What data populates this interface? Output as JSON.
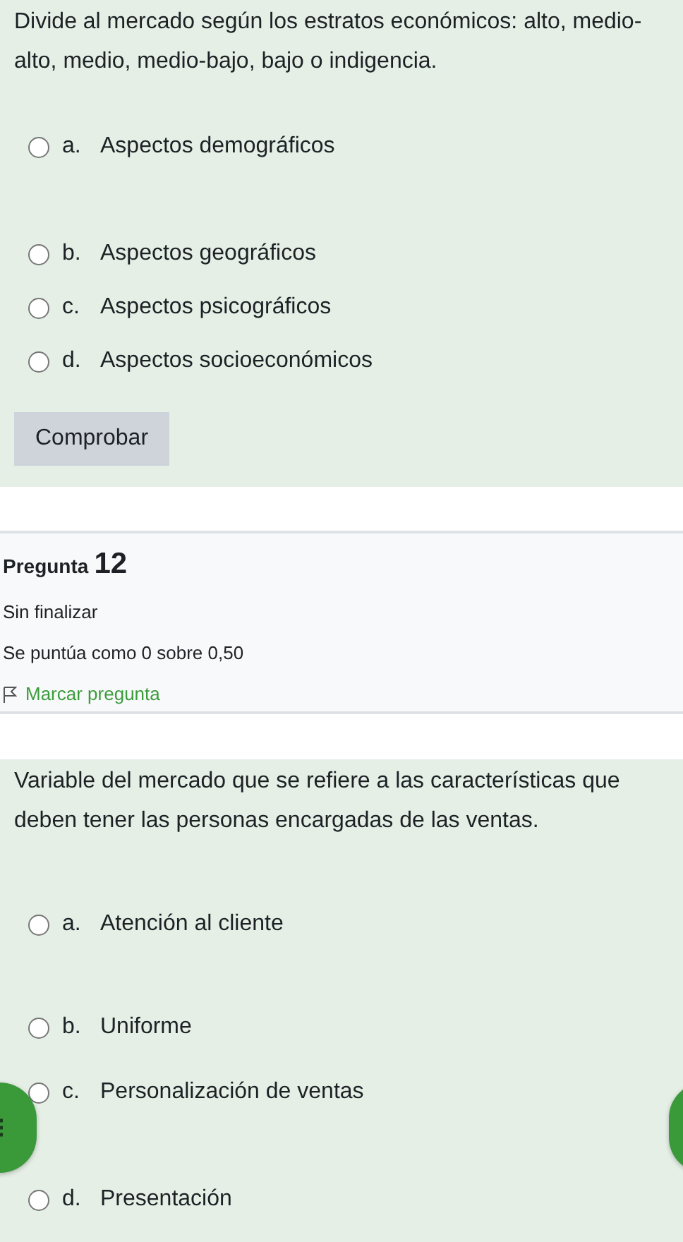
{
  "question_11": {
    "text": "Divide al  mercado según los estratos económicos: alto, medio-alto, medio, medio-bajo, bajo o indigencia.",
    "options": [
      {
        "letter": "a.",
        "text": "Aspectos demográficos",
        "selected": false
      },
      {
        "letter": "b.",
        "text": "Aspectos geográficos",
        "selected": false
      },
      {
        "letter": "c.",
        "text": "Aspectos psicográficos",
        "selected": false
      },
      {
        "letter": "d.",
        "text": "Aspectos socioeconómicos",
        "selected": false
      }
    ],
    "check_button": "Comprobar"
  },
  "question_12_info": {
    "label": "Pregunta",
    "number": "12",
    "status": "Sin finalizar",
    "grade": "Se puntúa como 0 sobre 0,50",
    "flag_link": "Marcar pregunta"
  },
  "question_12": {
    "text": "Variable del mercado que se  refiere a las características que deben tener las personas encargadas de las ventas.",
    "options": [
      {
        "letter": "a.",
        "text": "Atención al cliente",
        "selected": false
      },
      {
        "letter": "b.",
        "text": "Uniforme",
        "selected": false
      },
      {
        "letter": "c.",
        "text": "Personalización de ventas",
        "selected": false
      },
      {
        "letter": "d.",
        "text": "Presentación",
        "selected": false
      }
    ]
  }
}
